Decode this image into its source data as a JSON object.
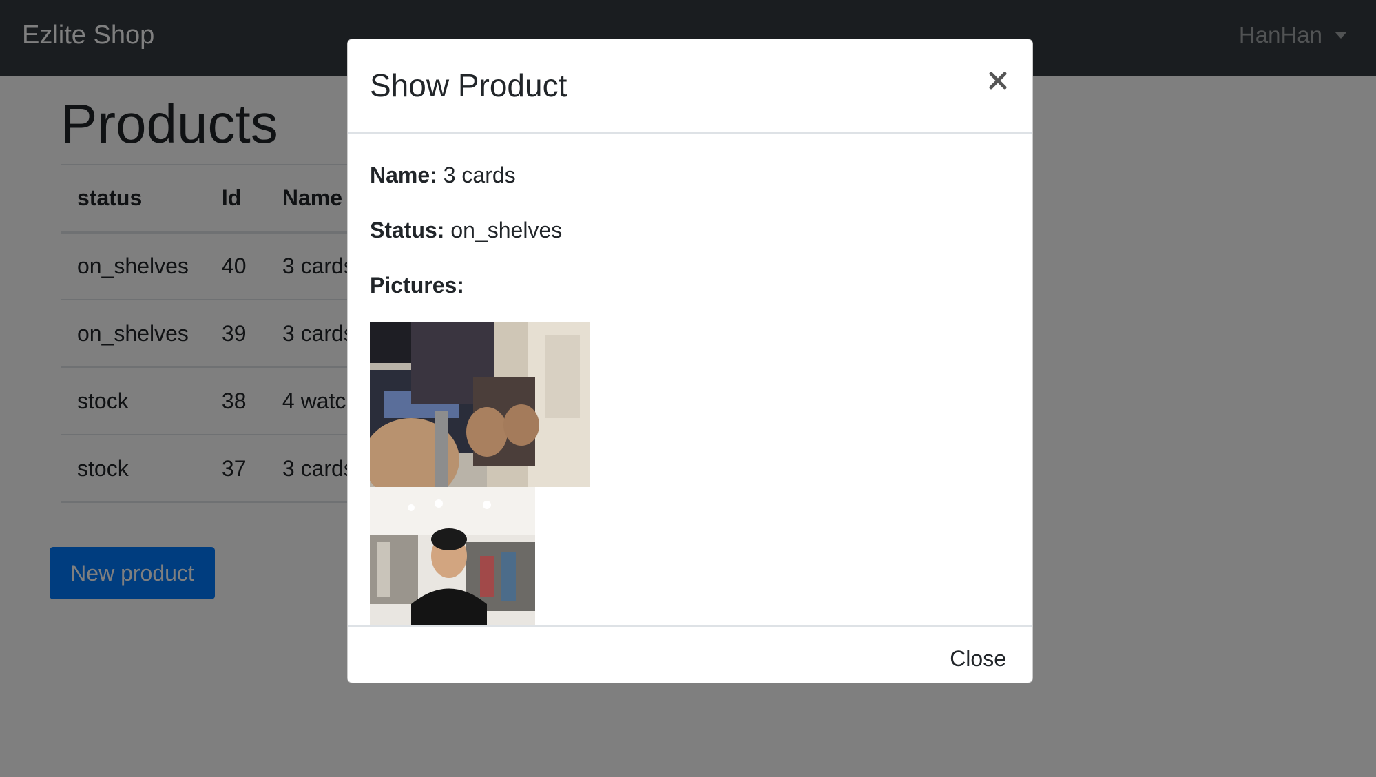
{
  "navbar": {
    "brand": "Ezlite Shop",
    "user": "HanHan"
  },
  "main": {
    "title": "Products",
    "table": {
      "headers": [
        "status",
        "Id",
        "Name"
      ],
      "rows": [
        {
          "status": "on_shelves",
          "id": "40",
          "name": "3 cards"
        },
        {
          "status": "on_shelves",
          "id": "39",
          "name": "3 cards"
        },
        {
          "status": "stock",
          "id": "38",
          "name": "4 watc"
        },
        {
          "status": "stock",
          "id": "37",
          "name": "3 cards"
        }
      ]
    },
    "new_button_label": "New product"
  },
  "modal": {
    "title": "Show Product",
    "name_label": "Name:",
    "name_value": "3 cards",
    "status_label": "Status:",
    "status_value": "on_shelves",
    "pictures_label": "Pictures:",
    "close_label": "Close",
    "close_icon": "times-icon"
  },
  "colors": {
    "navbar_bg": "#343a40",
    "primary": "#007bff",
    "backdrop": "rgba(0,0,0,0.5)",
    "border": "#dee2e6"
  }
}
